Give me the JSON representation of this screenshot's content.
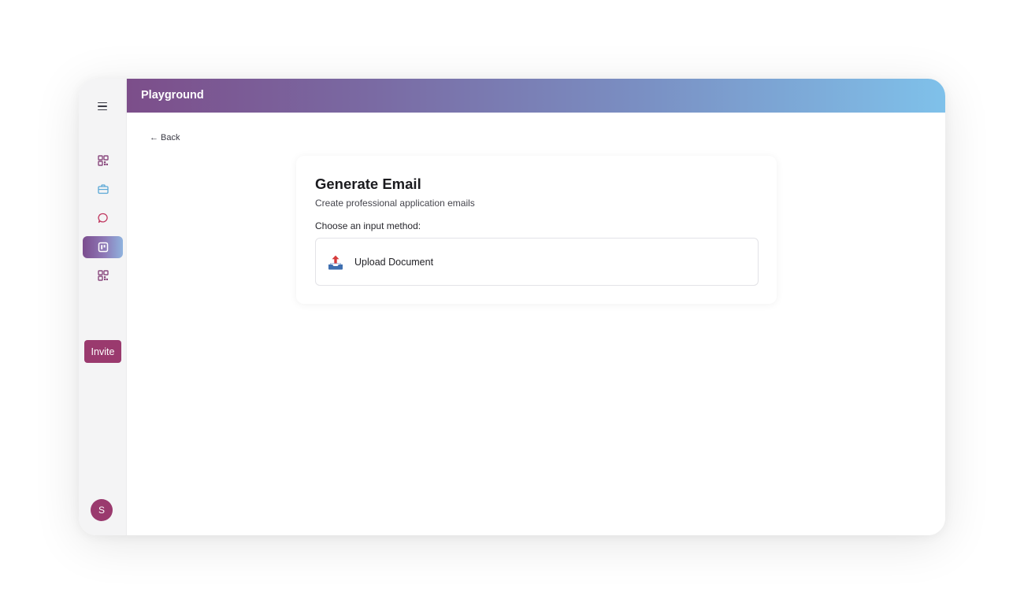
{
  "header": {
    "title": "Playground"
  },
  "sidebar": {
    "menu_icon": "hamburger-menu-icon",
    "items": [
      {
        "icon": "grid-apps-icon",
        "color": "#8a4a7e",
        "active": false
      },
      {
        "icon": "briefcase-icon",
        "color": "#5aa8d6",
        "active": false
      },
      {
        "icon": "chat-bubble-icon",
        "color": "#c0365f",
        "active": false
      },
      {
        "icon": "board-icon",
        "color": "#ffffff",
        "active": true
      },
      {
        "icon": "grid-apps-icon",
        "color": "#8a4a7e",
        "active": false
      }
    ],
    "invite_label": "Invite",
    "avatar_initial": "S"
  },
  "main": {
    "back_label": "Back",
    "card": {
      "title": "Generate Email",
      "subtitle": "Create professional application emails",
      "prompt": "Choose an input method:",
      "options": [
        {
          "icon": "upload-document-icon",
          "label": "Upload Document"
        }
      ]
    }
  },
  "colors": {
    "brand": "#9a3a6e",
    "header_gradient": [
      "#7c4e8a",
      "#7a8ec2",
      "#7fc1ea"
    ]
  }
}
